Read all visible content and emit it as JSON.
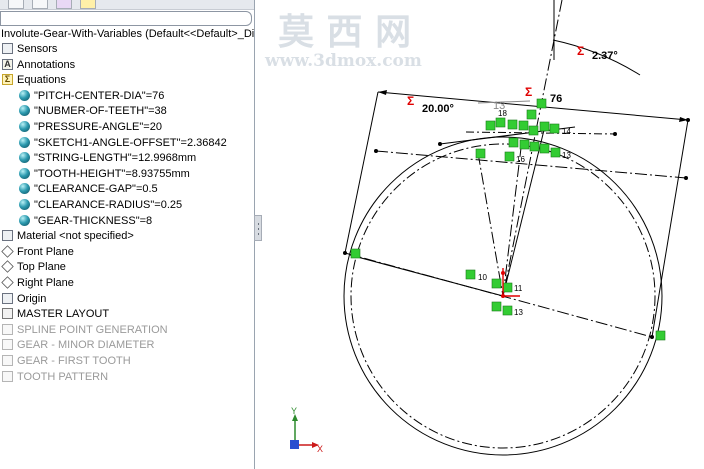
{
  "tree": {
    "root_label": "Involute-Gear-With-Variables  (Default<<Default>_Disp",
    "items": [
      {
        "label": "Sensors",
        "icon": "sensor-folder-icon"
      },
      {
        "label": "Annotations",
        "icon": "annotations-icon"
      },
      {
        "label": "Equations",
        "icon": "equations-icon"
      },
      {
        "label": "\"PITCH-CENTER-DIA\"=76",
        "icon": "global-variable-icon"
      },
      {
        "label": "\"NUBMER-OF-TEETH\"=38",
        "icon": "global-variable-icon"
      },
      {
        "label": "\"PRESSURE-ANGLE\"=20",
        "icon": "global-variable-icon"
      },
      {
        "label": "\"SKETCH1-ANGLE-OFFSET\"=2.36842",
        "icon": "global-variable-icon"
      },
      {
        "label": "\"STRING-LENGTH\"=12.9968mm",
        "icon": "global-variable-icon"
      },
      {
        "label": "\"TOOTH-HEIGHT\"=8.93755mm",
        "icon": "global-variable-icon"
      },
      {
        "label": "\"CLEARANCE-GAP\"=0.5",
        "icon": "global-variable-icon"
      },
      {
        "label": "\"CLEARANCE-RADIUS\"=0.25",
        "icon": "global-variable-icon"
      },
      {
        "label": "\"GEAR-THICKNESS\"=8",
        "icon": "global-variable-icon"
      },
      {
        "label": "Material <not specified>",
        "icon": "material-icon"
      },
      {
        "label": "Front Plane",
        "icon": "plane-icon"
      },
      {
        "label": "Top Plane",
        "icon": "plane-icon"
      },
      {
        "label": "Right Plane",
        "icon": "plane-icon"
      },
      {
        "label": "Origin",
        "icon": "origin-icon"
      },
      {
        "label": "MASTER LAYOUT",
        "icon": "sketch-icon"
      },
      {
        "label": "SPLINE POINT GENERATION",
        "icon": "sketch-icon",
        "disabled": true
      },
      {
        "label": "GEAR - MINOR DIAMETER",
        "icon": "sketch-icon",
        "disabled": true
      },
      {
        "label": "GEAR - FIRST TOOTH",
        "icon": "sketch-icon",
        "disabled": true
      },
      {
        "label": "TOOTH PATTERN",
        "icon": "sketch-icon",
        "disabled": true
      }
    ]
  },
  "graphics": {
    "dimensions": {
      "angle_offset": "2.37°",
      "pressure_angle": "20.00°",
      "pitch_diameter": "76",
      "string_length": "13"
    },
    "sigma_symbol": "Σ",
    "relation_labels": [
      "14",
      "13",
      "10",
      "11",
      "13",
      "16",
      "18"
    ],
    "triad": {
      "x": "X",
      "y": "Y"
    },
    "watermark": {
      "chars": "莫 西 网",
      "url": "www.3dmox.com"
    },
    "colors": {
      "relation_green": "#33cc33",
      "dimension_red": "#e00000",
      "sigma_red": "#e00000"
    }
  }
}
